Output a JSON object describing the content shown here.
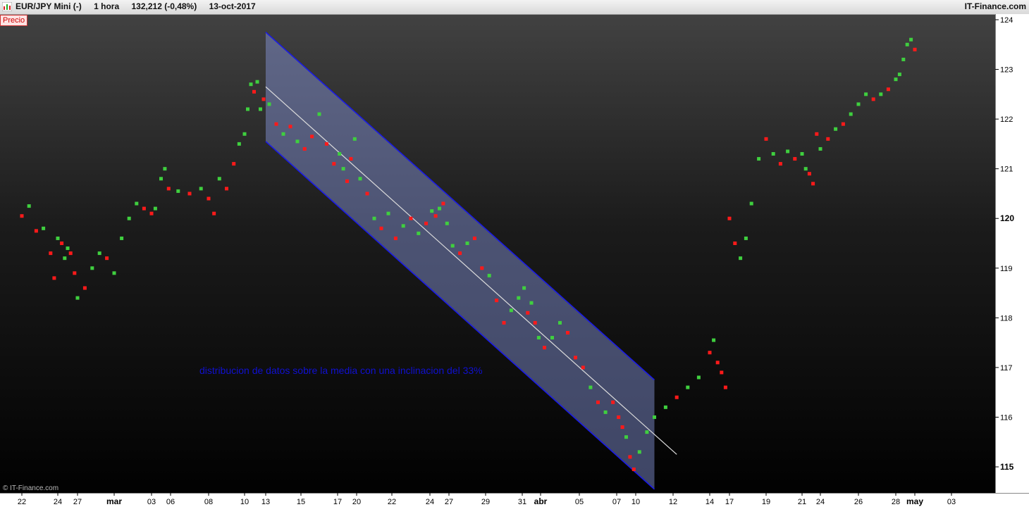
{
  "header": {
    "symbol": "EUR/JPY Mini (-)",
    "timeframe": "1 hora",
    "last_change": "132,212 (-0,48%)",
    "date": "13-oct-2017",
    "brand": "IT-Finance.com",
    "series_tag": "Precio"
  },
  "copyright": "© IT-Finance.com",
  "colors": {
    "up": "#3fcf3f",
    "down": "#ff1a1a",
    "channel_edge": "#1a1ae6",
    "channel_fill": "#8a9adf",
    "midline": "#dddddd"
  },
  "chart_data": {
    "type": "scatter",
    "y_range": [
      114.5,
      124.3
    ],
    "y_ticks": [
      {
        "value": 124,
        "label": "124",
        "bold": false
      },
      {
        "value": 123,
        "label": "123",
        "bold": false
      },
      {
        "value": 122,
        "label": "122",
        "bold": false
      },
      {
        "value": 121,
        "label": "121",
        "bold": false
      },
      {
        "value": 120,
        "label": "120",
        "bold": true
      },
      {
        "value": 119,
        "label": "119",
        "bold": false
      },
      {
        "value": 118,
        "label": "118",
        "bold": false
      },
      {
        "value": 117,
        "label": "117",
        "bold": false
      },
      {
        "value": 116,
        "label": "116",
        "bold": false
      },
      {
        "value": 115,
        "label": "115",
        "bold": true
      }
    ],
    "x_ticks": [
      {
        "i": 0,
        "label": "22",
        "bold": false
      },
      {
        "i": 1,
        "label": "24",
        "bold": false
      },
      {
        "i": 2,
        "label": "27",
        "bold": false
      },
      {
        "i": 3,
        "label": "mar",
        "bold": true
      },
      {
        "i": 4,
        "label": "03",
        "bold": false
      },
      {
        "i": 5,
        "label": "06",
        "bold": false
      },
      {
        "i": 6,
        "label": "08",
        "bold": false
      },
      {
        "i": 7,
        "label": "10",
        "bold": false
      },
      {
        "i": 8,
        "label": "13",
        "bold": false
      },
      {
        "i": 9,
        "label": "15",
        "bold": false
      },
      {
        "i": 10,
        "label": "17",
        "bold": false
      },
      {
        "i": 11,
        "label": "20",
        "bold": false
      },
      {
        "i": 12,
        "label": "22",
        "bold": false
      },
      {
        "i": 13,
        "label": "24",
        "bold": false
      },
      {
        "i": 14,
        "label": "27",
        "bold": false
      },
      {
        "i": 15,
        "label": "29",
        "bold": false
      },
      {
        "i": 16,
        "label": "31",
        "bold": false
      },
      {
        "i": 17,
        "label": "abr",
        "bold": true
      },
      {
        "i": 18,
        "label": "05",
        "bold": false
      },
      {
        "i": 19,
        "label": "07",
        "bold": false
      },
      {
        "i": 20,
        "label": "10",
        "bold": false
      },
      {
        "i": 21,
        "label": "12",
        "bold": false
      },
      {
        "i": 22,
        "label": "14",
        "bold": false
      },
      {
        "i": 23,
        "label": "17",
        "bold": false
      },
      {
        "i": 24,
        "label": "19",
        "bold": false
      },
      {
        "i": 25,
        "label": "21",
        "bold": false
      },
      {
        "i": 26,
        "label": "24",
        "bold": false
      },
      {
        "i": 27,
        "label": "26",
        "bold": false
      },
      {
        "i": 28,
        "label": "28",
        "bold": false
      },
      {
        "i": 29,
        "label": "may",
        "bold": true
      },
      {
        "i": 30,
        "label": "03",
        "bold": false
      }
    ],
    "series": [
      {
        "values": [
          {
            "x": 0,
            "y": 120.05,
            "dir": "down"
          },
          {
            "x": 0.2,
            "y": 120.25,
            "dir": "up"
          },
          {
            "x": 0.4,
            "y": 119.75,
            "dir": "down"
          },
          {
            "x": 0.6,
            "y": 119.8,
            "dir": "up"
          },
          {
            "x": 0.8,
            "y": 119.3,
            "dir": "down"
          },
          {
            "x": 0.9,
            "y": 118.8,
            "dir": "down"
          },
          {
            "x": 1.0,
            "y": 119.6,
            "dir": "up"
          },
          {
            "x": 1.2,
            "y": 119.5,
            "dir": "down"
          },
          {
            "x": 1.35,
            "y": 119.2,
            "dir": "up"
          },
          {
            "x": 1.5,
            "y": 119.4,
            "dir": "up"
          },
          {
            "x": 1.65,
            "y": 119.3,
            "dir": "down"
          },
          {
            "x": 1.85,
            "y": 118.9,
            "dir": "down"
          },
          {
            "x": 2.0,
            "y": 118.4,
            "dir": "up"
          },
          {
            "x": 2.2,
            "y": 118.6,
            "dir": "down"
          },
          {
            "x": 2.4,
            "y": 119.0,
            "dir": "up"
          },
          {
            "x": 2.6,
            "y": 119.3,
            "dir": "up"
          },
          {
            "x": 2.8,
            "y": 119.2,
            "dir": "down"
          },
          {
            "x": 3.0,
            "y": 118.9,
            "dir": "up"
          },
          {
            "x": 3.2,
            "y": 119.6,
            "dir": "up"
          },
          {
            "x": 3.4,
            "y": 120.0,
            "dir": "up"
          },
          {
            "x": 3.6,
            "y": 120.3,
            "dir": "up"
          },
          {
            "x": 3.8,
            "y": 120.2,
            "dir": "down"
          },
          {
            "x": 4.0,
            "y": 120.1,
            "dir": "down"
          },
          {
            "x": 4.2,
            "y": 120.2,
            "dir": "up"
          },
          {
            "x": 4.5,
            "y": 120.8,
            "dir": "up"
          },
          {
            "x": 4.7,
            "y": 121.0,
            "dir": "up"
          },
          {
            "x": 4.9,
            "y": 120.6,
            "dir": "down"
          },
          {
            "x": 5.2,
            "y": 120.55,
            "dir": "up"
          },
          {
            "x": 5.5,
            "y": 120.5,
            "dir": "down"
          },
          {
            "x": 5.8,
            "y": 120.6,
            "dir": "up"
          },
          {
            "x": 6.0,
            "y": 120.4,
            "dir": "down"
          },
          {
            "x": 6.15,
            "y": 120.1,
            "dir": "down"
          },
          {
            "x": 6.3,
            "y": 120.8,
            "dir": "up"
          },
          {
            "x": 6.5,
            "y": 120.6,
            "dir": "down"
          },
          {
            "x": 6.7,
            "y": 121.1,
            "dir": "down"
          },
          {
            "x": 6.85,
            "y": 121.5,
            "dir": "up"
          },
          {
            "x": 7.0,
            "y": 121.7,
            "dir": "up"
          },
          {
            "x": 7.15,
            "y": 122.2,
            "dir": "up"
          },
          {
            "x": 7.3,
            "y": 122.7,
            "dir": "up"
          },
          {
            "x": 7.45,
            "y": 122.55,
            "dir": "down"
          },
          {
            "x": 7.6,
            "y": 122.75,
            "dir": "up"
          },
          {
            "x": 7.75,
            "y": 122.2,
            "dir": "up"
          },
          {
            "x": 7.9,
            "y": 122.4,
            "dir": "down"
          },
          {
            "x": 8.1,
            "y": 122.3,
            "dir": "up"
          },
          {
            "x": 8.3,
            "y": 121.9,
            "dir": "down"
          },
          {
            "x": 8.5,
            "y": 121.7,
            "dir": "up"
          },
          {
            "x": 8.7,
            "y": 121.85,
            "dir": "down"
          },
          {
            "x": 8.9,
            "y": 121.55,
            "dir": "up"
          },
          {
            "x": 9.1,
            "y": 121.4,
            "dir": "down"
          },
          {
            "x": 9.3,
            "y": 121.65,
            "dir": "down"
          },
          {
            "x": 9.5,
            "y": 122.1,
            "dir": "up"
          },
          {
            "x": 9.7,
            "y": 121.5,
            "dir": "down"
          },
          {
            "x": 9.9,
            "y": 121.1,
            "dir": "down"
          },
          {
            "x": 10.1,
            "y": 121.3,
            "dir": "up"
          },
          {
            "x": 10.3,
            "y": 121.0,
            "dir": "up"
          },
          {
            "x": 10.5,
            "y": 120.75,
            "dir": "down"
          },
          {
            "x": 10.7,
            "y": 121.2,
            "dir": "down"
          },
          {
            "x": 10.9,
            "y": 121.6,
            "dir": "up"
          },
          {
            "x": 11.1,
            "y": 120.8,
            "dir": "up"
          },
          {
            "x": 11.3,
            "y": 120.5,
            "dir": "down"
          },
          {
            "x": 11.5,
            "y": 120.0,
            "dir": "up"
          },
          {
            "x": 11.7,
            "y": 119.8,
            "dir": "down"
          },
          {
            "x": 11.9,
            "y": 120.1,
            "dir": "up"
          },
          {
            "x": 12.1,
            "y": 119.6,
            "dir": "down"
          },
          {
            "x": 12.3,
            "y": 119.85,
            "dir": "up"
          },
          {
            "x": 12.5,
            "y": 120.0,
            "dir": "down"
          },
          {
            "x": 12.7,
            "y": 119.7,
            "dir": "up"
          },
          {
            "x": 12.9,
            "y": 119.9,
            "dir": "down"
          },
          {
            "x": 13.1,
            "y": 120.15,
            "dir": "up"
          },
          {
            "x": 13.3,
            "y": 120.05,
            "dir": "down"
          },
          {
            "x": 13.5,
            "y": 120.2,
            "dir": "up"
          },
          {
            "x": 13.7,
            "y": 120.3,
            "dir": "down"
          },
          {
            "x": 13.9,
            "y": 119.9,
            "dir": "up"
          },
          {
            "x": 14.1,
            "y": 119.45,
            "dir": "up"
          },
          {
            "x": 14.3,
            "y": 119.3,
            "dir": "down"
          },
          {
            "x": 14.5,
            "y": 119.5,
            "dir": "up"
          },
          {
            "x": 14.7,
            "y": 119.6,
            "dir": "down"
          },
          {
            "x": 14.9,
            "y": 119.0,
            "dir": "down"
          },
          {
            "x": 15.1,
            "y": 118.85,
            "dir": "up"
          },
          {
            "x": 15.3,
            "y": 118.35,
            "dir": "down"
          },
          {
            "x": 15.5,
            "y": 117.9,
            "dir": "down"
          },
          {
            "x": 15.7,
            "y": 118.15,
            "dir": "up"
          },
          {
            "x": 15.9,
            "y": 118.4,
            "dir": "up"
          },
          {
            "x": 16.1,
            "y": 118.6,
            "dir": "up"
          },
          {
            "x": 16.3,
            "y": 118.1,
            "dir": "down"
          },
          {
            "x": 16.5,
            "y": 118.3,
            "dir": "up"
          },
          {
            "x": 16.7,
            "y": 117.9,
            "dir": "down"
          },
          {
            "x": 16.9,
            "y": 117.6,
            "dir": "up"
          },
          {
            "x": 17.1,
            "y": 117.4,
            "dir": "down"
          },
          {
            "x": 17.3,
            "y": 117.6,
            "dir": "up"
          },
          {
            "x": 17.5,
            "y": 117.9,
            "dir": "up"
          },
          {
            "x": 17.7,
            "y": 117.7,
            "dir": "down"
          },
          {
            "x": 17.9,
            "y": 117.2,
            "dir": "down"
          },
          {
            "x": 18.1,
            "y": 117.0,
            "dir": "down"
          },
          {
            "x": 18.3,
            "y": 116.6,
            "dir": "up"
          },
          {
            "x": 18.5,
            "y": 116.3,
            "dir": "down"
          },
          {
            "x": 18.7,
            "y": 116.1,
            "dir": "up"
          },
          {
            "x": 18.9,
            "y": 116.3,
            "dir": "down"
          },
          {
            "x": 19.1,
            "y": 116.0,
            "dir": "down"
          },
          {
            "x": 19.3,
            "y": 115.8,
            "dir": "down"
          },
          {
            "x": 19.5,
            "y": 115.6,
            "dir": "up"
          },
          {
            "x": 19.7,
            "y": 115.2,
            "dir": "down"
          },
          {
            "x": 19.9,
            "y": 114.95,
            "dir": "down"
          },
          {
            "x": 20.1,
            "y": 115.3,
            "dir": "up"
          },
          {
            "x": 20.3,
            "y": 115.7,
            "dir": "up"
          },
          {
            "x": 20.5,
            "y": 116.0,
            "dir": "up"
          },
          {
            "x": 20.8,
            "y": 116.2,
            "dir": "up"
          },
          {
            "x": 21.1,
            "y": 116.4,
            "dir": "down"
          },
          {
            "x": 21.4,
            "y": 116.6,
            "dir": "up"
          },
          {
            "x": 21.7,
            "y": 116.8,
            "dir": "up"
          },
          {
            "x": 22.0,
            "y": 117.3,
            "dir": "down"
          },
          {
            "x": 22.2,
            "y": 117.55,
            "dir": "up"
          },
          {
            "x": 22.4,
            "y": 117.1,
            "dir": "down"
          },
          {
            "x": 22.6,
            "y": 116.9,
            "dir": "down"
          },
          {
            "x": 22.8,
            "y": 116.6,
            "dir": "down"
          },
          {
            "x": 23.0,
            "y": 120.0,
            "dir": "down"
          },
          {
            "x": 23.15,
            "y": 119.5,
            "dir": "down"
          },
          {
            "x": 23.3,
            "y": 119.2,
            "dir": "up"
          },
          {
            "x": 23.45,
            "y": 119.6,
            "dir": "up"
          },
          {
            "x": 23.6,
            "y": 120.3,
            "dir": "up"
          },
          {
            "x": 23.8,
            "y": 121.2,
            "dir": "up"
          },
          {
            "x": 24.0,
            "y": 121.6,
            "dir": "down"
          },
          {
            "x": 24.2,
            "y": 121.3,
            "dir": "up"
          },
          {
            "x": 24.4,
            "y": 121.1,
            "dir": "down"
          },
          {
            "x": 24.6,
            "y": 121.35,
            "dir": "up"
          },
          {
            "x": 24.8,
            "y": 121.2,
            "dir": "down"
          },
          {
            "x": 25.0,
            "y": 121.3,
            "dir": "up"
          },
          {
            "x": 25.2,
            "y": 121.0,
            "dir": "up"
          },
          {
            "x": 25.4,
            "y": 120.9,
            "dir": "down"
          },
          {
            "x": 25.6,
            "y": 120.7,
            "dir": "down"
          },
          {
            "x": 25.8,
            "y": 121.7,
            "dir": "down"
          },
          {
            "x": 26.0,
            "y": 121.4,
            "dir": "up"
          },
          {
            "x": 26.2,
            "y": 121.6,
            "dir": "down"
          },
          {
            "x": 26.4,
            "y": 121.8,
            "dir": "up"
          },
          {
            "x": 26.6,
            "y": 121.9,
            "dir": "down"
          },
          {
            "x": 26.8,
            "y": 122.1,
            "dir": "up"
          },
          {
            "x": 27.0,
            "y": 122.3,
            "dir": "up"
          },
          {
            "x": 27.2,
            "y": 122.5,
            "dir": "up"
          },
          {
            "x": 27.4,
            "y": 122.4,
            "dir": "down"
          },
          {
            "x": 27.6,
            "y": 122.5,
            "dir": "up"
          },
          {
            "x": 27.8,
            "y": 122.6,
            "dir": "down"
          },
          {
            "x": 28.0,
            "y": 122.8,
            "dir": "up"
          },
          {
            "x": 28.2,
            "y": 122.9,
            "dir": "up"
          },
          {
            "x": 28.4,
            "y": 123.2,
            "dir": "up"
          },
          {
            "x": 28.6,
            "y": 123.5,
            "dir": "up"
          },
          {
            "x": 28.8,
            "y": 123.6,
            "dir": "up"
          },
          {
            "x": 29.0,
            "y": 123.4,
            "dir": "down"
          }
        ]
      }
    ],
    "channel": {
      "x_start": 8.0,
      "x_end": 20.5,
      "upper_start": 123.75,
      "upper_end": 116.75,
      "lower_start": 121.55,
      "lower_end": 114.55,
      "mid_start": 122.65,
      "mid_end": 115.45
    },
    "annotation": "distribucion de datos sobre la media con una inclinacion del 33%"
  }
}
